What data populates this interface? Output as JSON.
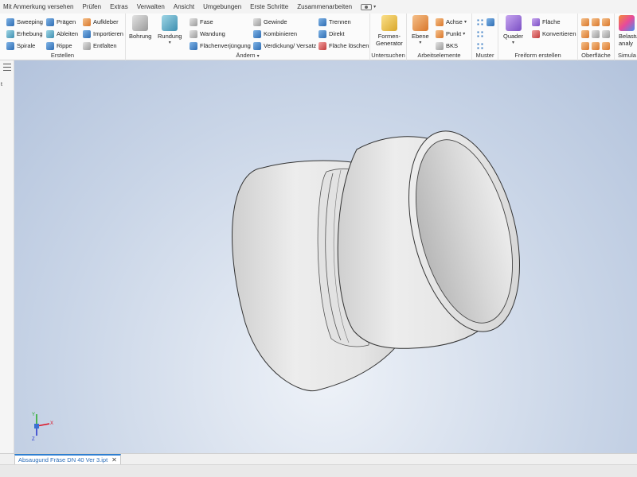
{
  "menu_tabs": [
    "Mit Anmerkung versehen",
    "Prüfen",
    "Extras",
    "Verwalten",
    "Ansicht",
    "Umgebungen",
    "Erste Schritte",
    "Zusammenarbeiten"
  ],
  "ribbon": {
    "erstellen": {
      "title": "Erstellen",
      "col1": [
        "Sweeping",
        "Erhebung",
        "Spirale"
      ],
      "col2": [
        "Prägen",
        "Ableiten",
        "Rippe"
      ],
      "col3": [
        "Aufkleber",
        "Importieren",
        "Entfalten"
      ]
    },
    "aendern": {
      "title": "Ändern",
      "bohrung": "Bohrung",
      "rundung": "Rundung",
      "col1": [
        "Fase",
        "Wandung",
        "Flächenverjüngung"
      ],
      "col2": [
        "Gewinde",
        "Kombinieren",
        "Verdickung/ Versatz"
      ],
      "col3": [
        "Trennen",
        "Direkt",
        "Fläche löschen"
      ]
    },
    "untersuchen": {
      "title": "Untersuchen",
      "formen_generator": "Formen-\nGenerator"
    },
    "arbeitselemente": {
      "title": "Arbeitselemente",
      "ebene": "Ebene",
      "items": [
        "Achse",
        "Punkt",
        "BKS"
      ]
    },
    "muster": {
      "title": "Muster"
    },
    "freiform": {
      "title": "Freiform erstellen",
      "quader": "Quader",
      "items": [
        "Fläche",
        "Konvertieren"
      ]
    },
    "oberflaeche": {
      "title": "Oberfläche"
    },
    "simulation": {
      "title": "Simula",
      "label": "Belastu\nanaly"
    }
  },
  "document_tab": {
    "name": "Absaugund Fräse DN 40 Ver 3.ipt",
    "close": "✕"
  },
  "triad": {
    "x": "X",
    "y": "Y",
    "z": "Z"
  },
  "colors": {
    "viewport_top": "#b3c3dc",
    "viewport_center": "#eef2f8",
    "model": "#e6e6e6",
    "accent": "#2f7fd1"
  }
}
